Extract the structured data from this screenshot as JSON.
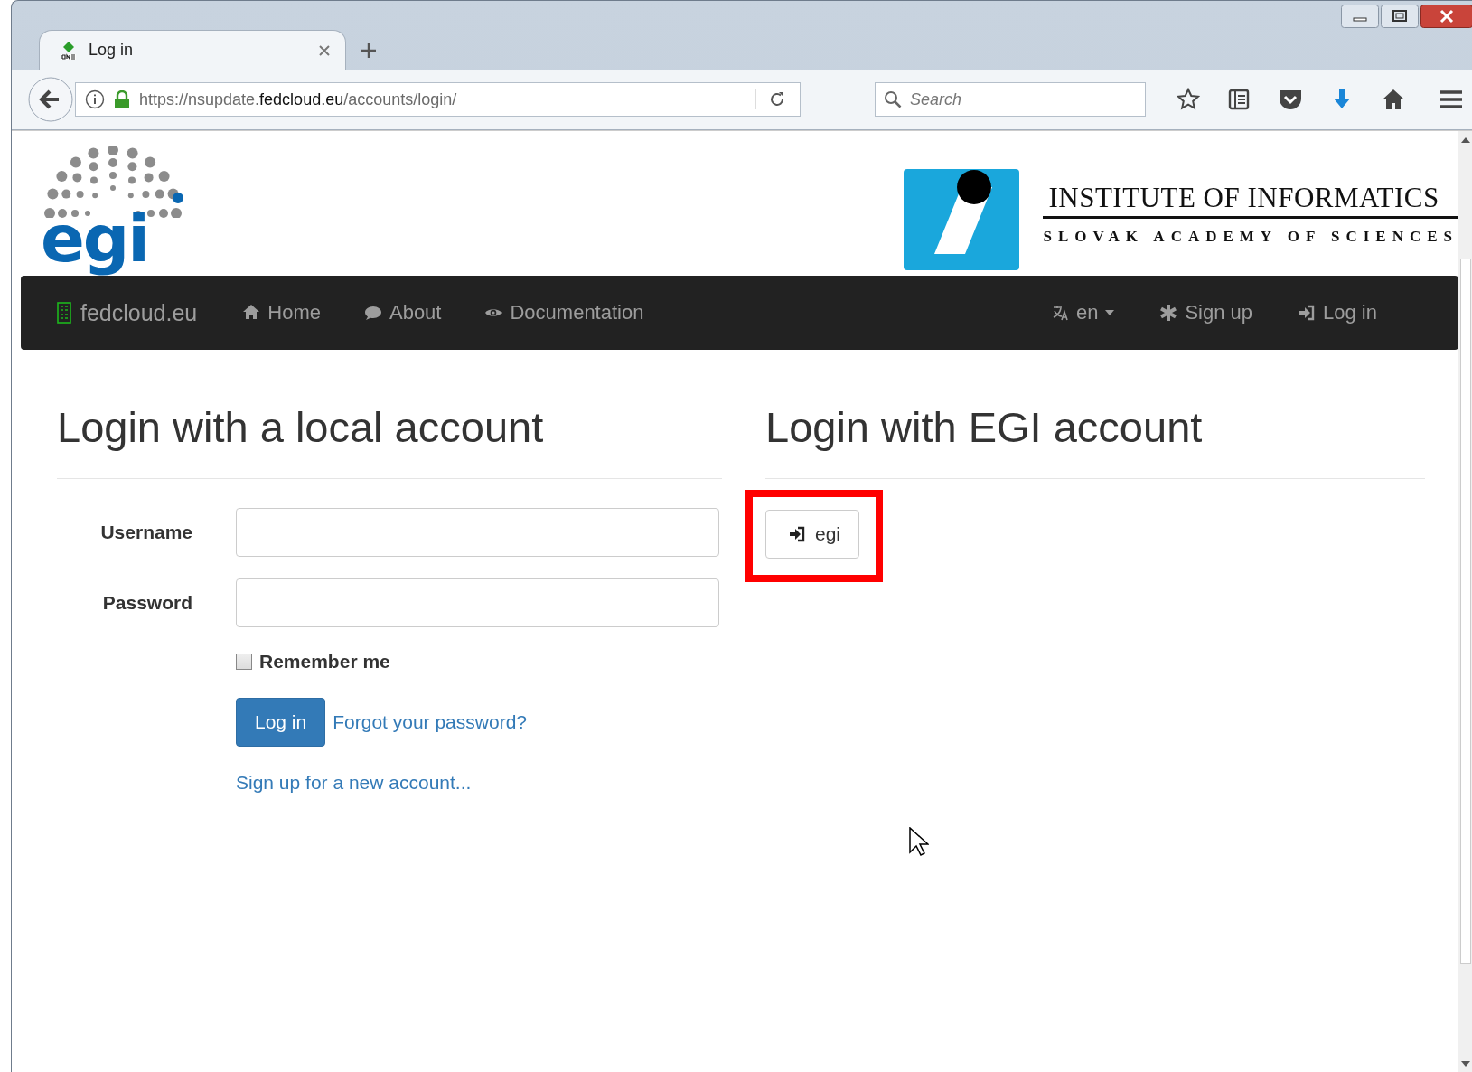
{
  "tabs": [
    {
      "title": "Log in",
      "selected": true
    }
  ],
  "address_bar": {
    "url": "https://nsupdate.**fedcloud.eu**/accounts/login/"
  },
  "search": {
    "placeholder": "Search"
  },
  "header": {
    "logo_left": "egi",
    "logo_right_title": "INSTITUTE OF INFORMATICS",
    "logo_right_subtitle": "SLOVAK ACADEMY OF SCIENCES"
  },
  "navbar": {
    "brand": "fedcloud.eu",
    "left": [
      {
        "label": "Home",
        "kind": "home"
      },
      {
        "label": "About",
        "kind": "about"
      },
      {
        "label": "Documentation",
        "kind": "docs"
      }
    ],
    "right": [
      {
        "label": "en",
        "kind": "language"
      },
      {
        "label": "Sign up",
        "kind": "signup"
      },
      {
        "label": "Log in",
        "kind": "login"
      }
    ]
  },
  "local_login": {
    "heading": "Login with a local account",
    "fields": [
      {
        "label": "Username"
      },
      {
        "label": "Password"
      }
    ],
    "remember": {
      "label": "Remember me",
      "checked": false
    },
    "submit": "Log in",
    "forgot": "Forgot your password?",
    "signup": "Sign up for a new account..."
  },
  "egi_login": {
    "heading": "Login with EGI account",
    "button": "egi",
    "highlighted": true
  }
}
